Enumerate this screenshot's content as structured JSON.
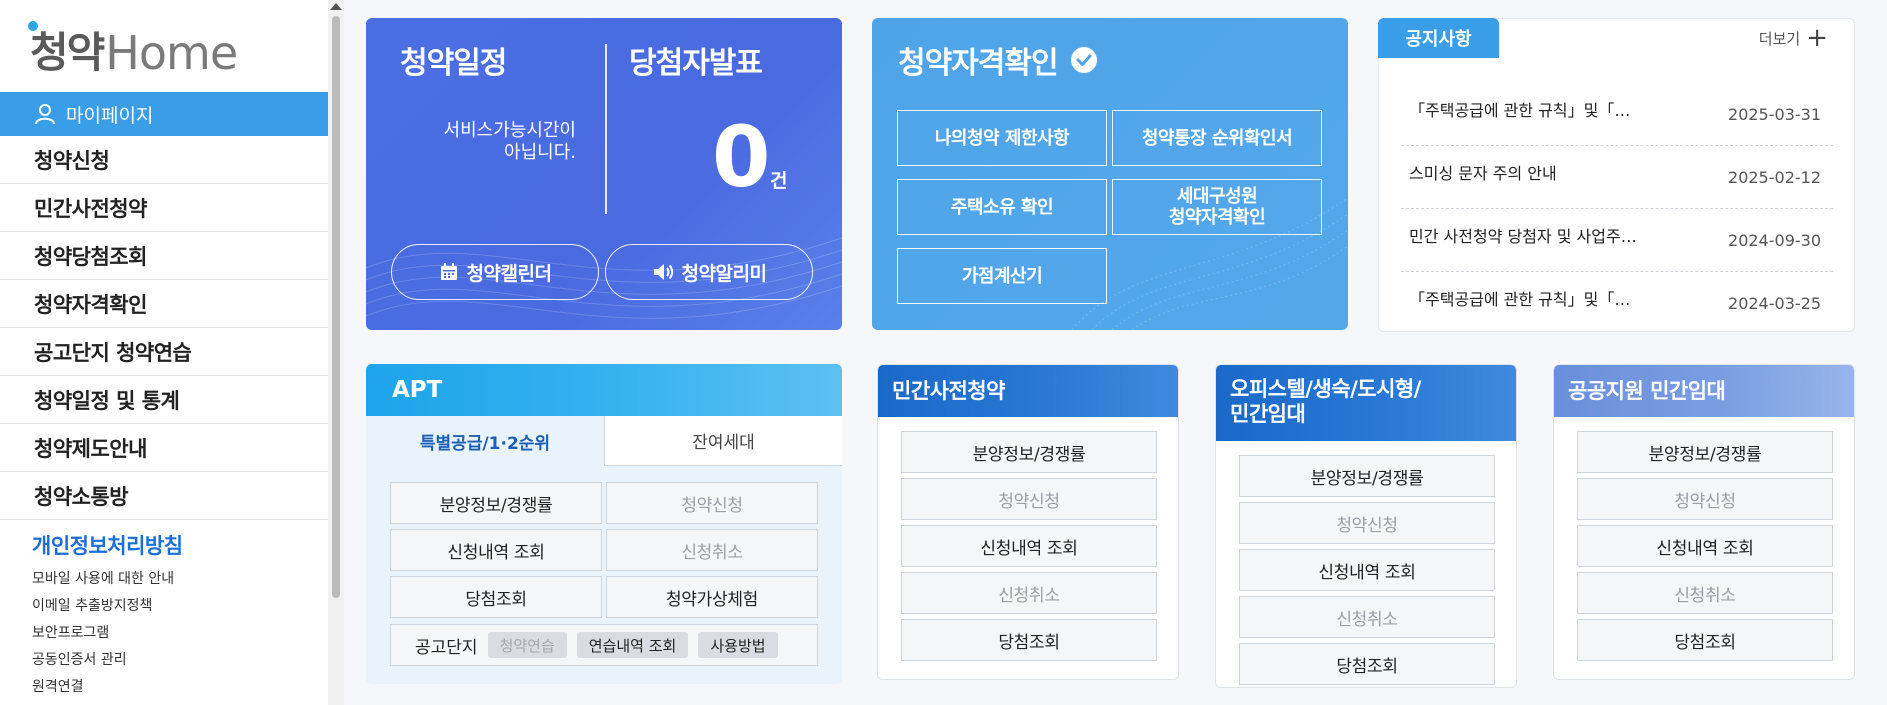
{
  "logo": {
    "korean": "청약",
    "english": "Home"
  },
  "sidebar": {
    "mypage": "마이페이지",
    "items": [
      "청약신청",
      "민간사전청약",
      "청약당첨조회",
      "청약자격확인",
      "공고단지 청약연습",
      "청약일정 및 통계",
      "청약제도안내",
      "청약소통방"
    ],
    "privacy": "개인정보처리방침",
    "links": [
      "모바일 사용에 대한 안내",
      "이메일 추출방지정책",
      "보안프로그램",
      "공동인증서 관리",
      "원격연결"
    ]
  },
  "schedule": {
    "title": "청약일정",
    "message_line1": "서비스가능시간이",
    "message_line2": "아닙니다.",
    "winner_title": "당첨자발표",
    "winner_count": "0",
    "winner_unit": "건",
    "calendar_btn": "청약캘린더",
    "alarm_btn": "청약알리미"
  },
  "eligibility": {
    "title": "청약자격확인",
    "buttons": [
      "나의청약 제한사항",
      "청약통장 순위확인서",
      "주택소유 확인",
      "세대구성원",
      "청약자격확인",
      "가점계산기"
    ]
  },
  "notice": {
    "tab": "공지사항",
    "more": "더보기",
    "items": [
      {
        "title": "「주택공급에 관한 규칙」및「…",
        "date": "2025-03-31"
      },
      {
        "title": "스미싱 문자 주의 안내",
        "date": "2025-02-12"
      },
      {
        "title": "민간 사전청약 당첨자 및 사업주…",
        "date": "2024-09-30"
      },
      {
        "title": "「주택공급에 관한 규칙」및「…",
        "date": "2024-03-25"
      }
    ]
  },
  "apt": {
    "title": "APT",
    "tab_special": "특별공급/1·2순위",
    "tab_remain": "잔여세대",
    "buttons": [
      "분양정보/경쟁률",
      "청약신청",
      "신청내역 조회",
      "신청취소",
      "당첨조회",
      "청약가상체험"
    ],
    "practice_label": "공고단지",
    "chips": [
      "청약연습",
      "연습내역 조회",
      "사용방법"
    ]
  },
  "private_pre": {
    "title": "민간사전청약",
    "buttons": [
      "분양정보/경쟁률",
      "청약신청",
      "신청내역 조회",
      "신청취소",
      "당첨조회"
    ]
  },
  "officetel": {
    "title_line1": "오피스텔/생숙/도시형/",
    "title_line2": "민간임대",
    "buttons": [
      "분양정보/경쟁률",
      "청약신청",
      "신청내역 조회",
      "신청취소",
      "당첨조회"
    ]
  },
  "public_rental": {
    "title": "공공지원 민간임대",
    "buttons": [
      "분양정보/경쟁률",
      "청약신청",
      "신청내역 조회",
      "신청취소",
      "당첨조회"
    ]
  },
  "colors": {
    "accent": "#3a9de8",
    "schedule_bg": "#4b6fe3",
    "eligibility_bg": "#4fa4e8",
    "privacy": "#1a6fd6"
  }
}
